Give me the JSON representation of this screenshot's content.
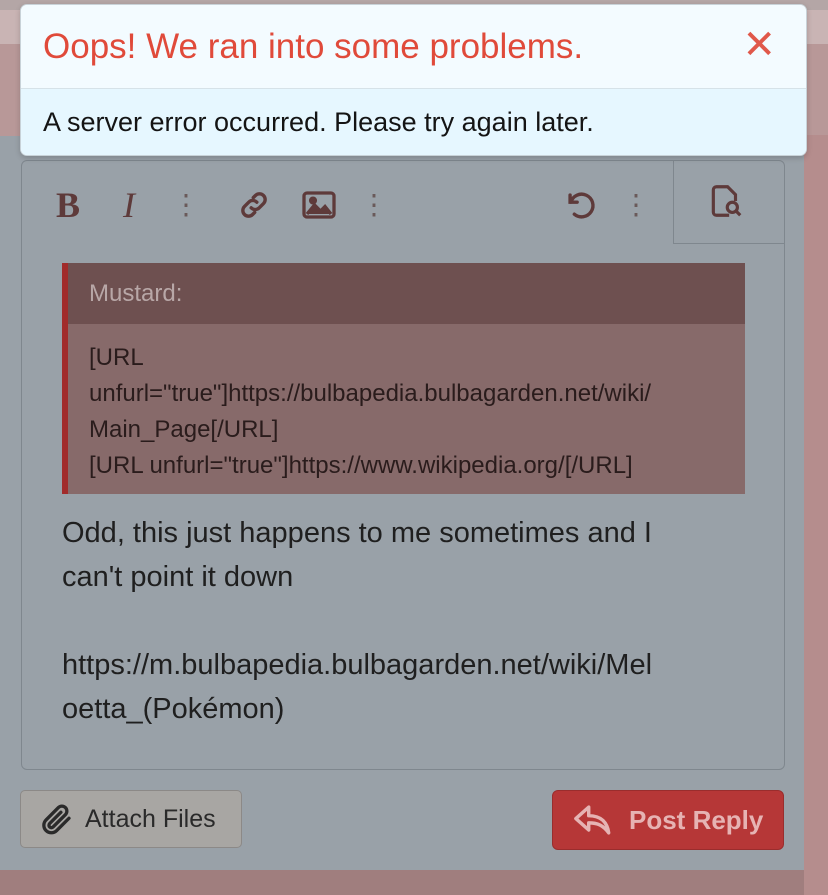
{
  "alert": {
    "title": "Oops! We ran into some problems.",
    "close_glyph": "✕",
    "message": "A server error occurred. Please try again later."
  },
  "toolbar": {
    "bold": "B",
    "italic": "I",
    "icons": [
      "bold-icon",
      "italic-icon",
      "more-options-icon",
      "link-icon",
      "image-icon",
      "more-options-icon",
      "undo-icon",
      "more-options-icon",
      "preview-icon"
    ]
  },
  "quote": {
    "author": "Mustard:",
    "lines": [
      "[URL",
      "unfurl=\"true\"]https://bulbapedia.bulbagarden.net/wiki/",
      "Main_Page[/URL]",
      "[URL unfurl=\"true\"]https://www.wikipedia.org/[/URL]"
    ]
  },
  "message": {
    "lines": [
      "Odd, this just happens to me sometimes and I",
      "can't point it down",
      "https://m.bulbapedia.bulbagarden.net/wiki/Mel",
      "oetta_(Pokémon)"
    ]
  },
  "buttons": {
    "attach_label": "Attach Files",
    "post_label": "Post Reply"
  },
  "colors": {
    "alert_title": "#e04a3a",
    "post_button": "#b63737",
    "quote_border": "#a12b2b"
  }
}
